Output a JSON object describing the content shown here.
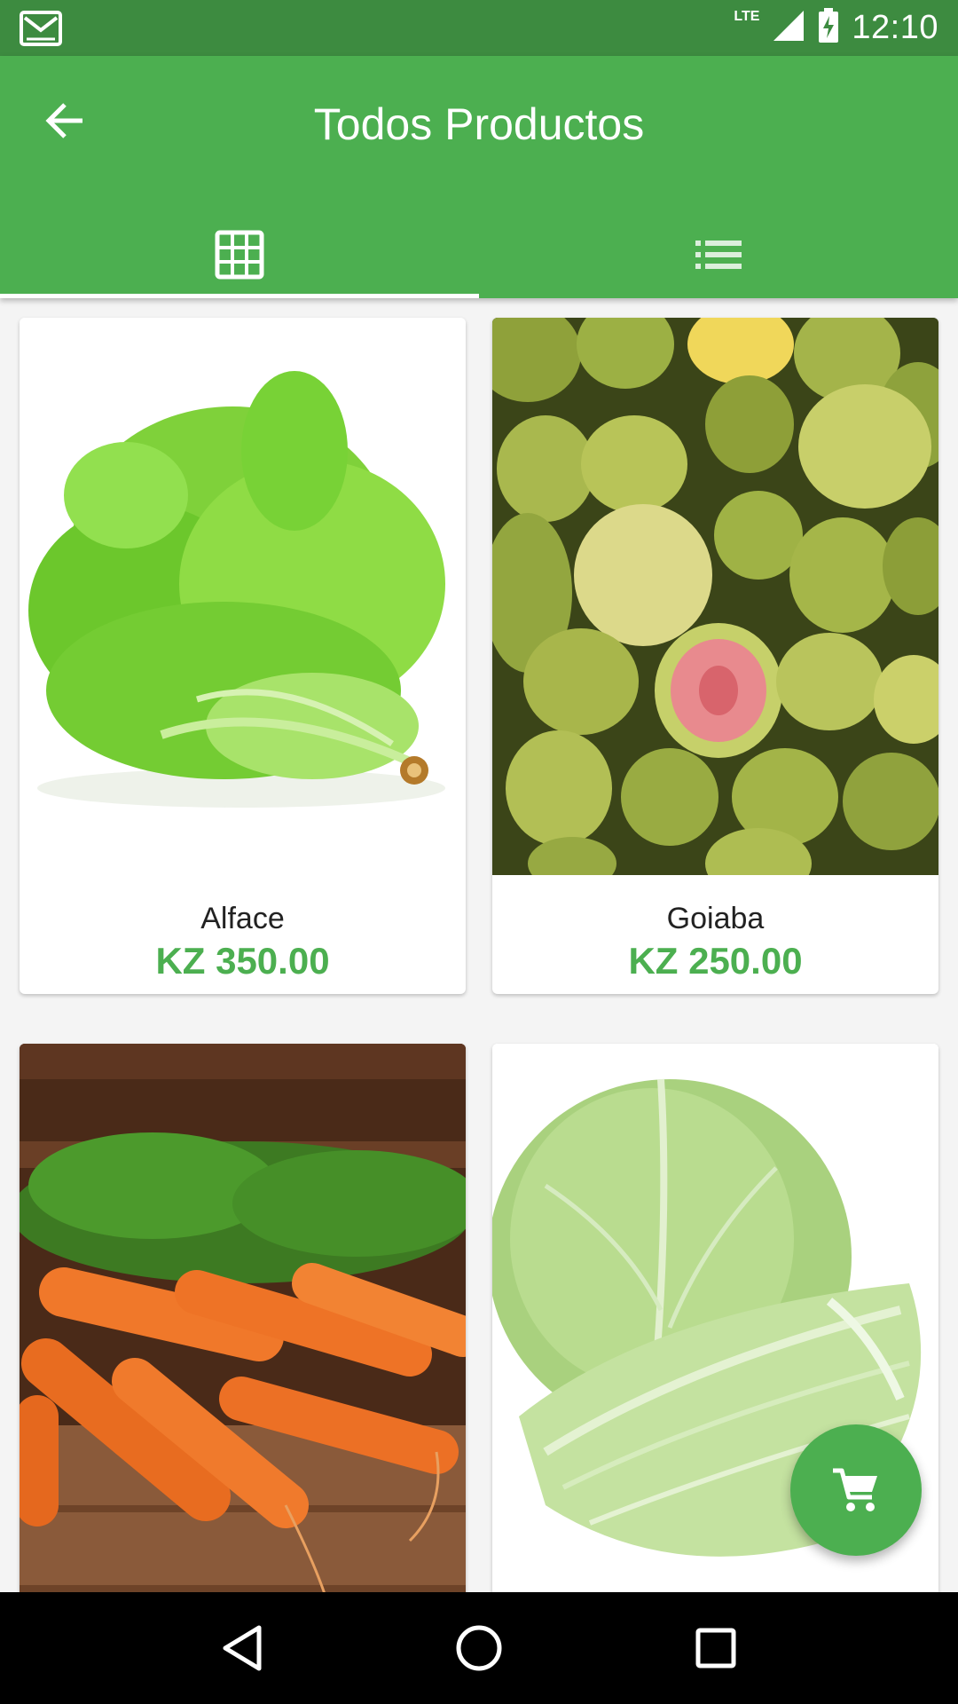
{
  "status_bar": {
    "time": "12:10",
    "network": "LTE",
    "icons": [
      "gmail-icon",
      "signal-icon",
      "battery-icon"
    ]
  },
  "app_bar": {
    "title": "Todos Productos",
    "back_icon": "arrow-back-icon"
  },
  "tabs": [
    {
      "name": "grid-view",
      "icon": "grid-icon",
      "active": true
    },
    {
      "name": "list-view",
      "icon": "list-icon",
      "active": false
    }
  ],
  "products": [
    {
      "name": "Alface",
      "price": "KZ 350.00",
      "image": "lettuce"
    },
    {
      "name": "Goiaba",
      "price": "KZ 250.00",
      "image": "guava"
    },
    {
      "name": "",
      "price": "",
      "image": "carrots"
    },
    {
      "name": "",
      "price": "",
      "image": "cabbage"
    }
  ],
  "fab": {
    "icon": "shopping-cart-icon"
  },
  "nav_bar": {
    "icons": [
      "back-triangle-icon",
      "home-circle-icon",
      "recents-square-icon"
    ]
  },
  "colors": {
    "primary": "#4caf50",
    "primary_dark": "#3d8b40",
    "price": "#4caf50"
  }
}
